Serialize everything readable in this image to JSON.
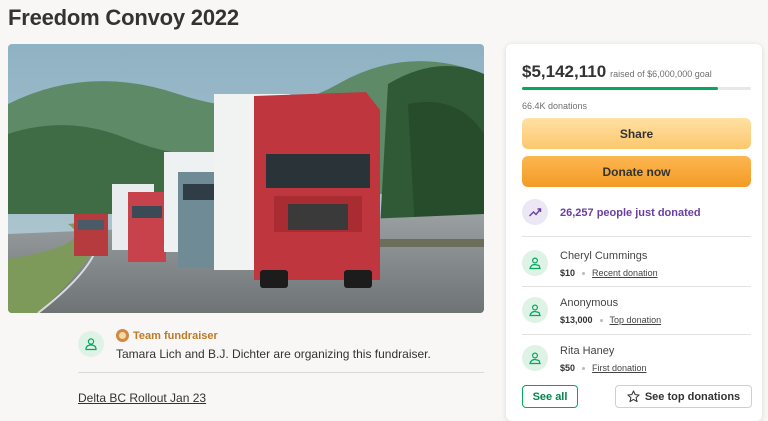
{
  "page": {
    "title": "Freedom Convoy 2022"
  },
  "campaign": {
    "raised_amount": "$5,142,110",
    "raised_goal_text": "raised of $6,000,000 goal",
    "progress_fraction": 0.857,
    "donation_count": "66.4K donations",
    "share_label": "Share",
    "donate_label": "Donate now",
    "recent_activity": "26,257 people just donated"
  },
  "donations": [
    {
      "name": "Cheryl Cummings",
      "amount": "$10",
      "tag": "Recent donation"
    },
    {
      "name": "Anonymous",
      "amount": "$13,000",
      "tag": "Top donation"
    },
    {
      "name": "Rita Haney",
      "amount": "$50",
      "tag": "First donation"
    }
  ],
  "buttons": {
    "see_all": "See all",
    "see_top": "See top donations"
  },
  "organizer": {
    "team_label": "Team fundraiser",
    "description": "Tamara Lich and B.J. Dichter are organizing this fundraiser."
  },
  "update": {
    "link_text": "Delta BC Rollout Jan 23"
  },
  "colors": {
    "accent_green": "#02a95c",
    "donate_orange": "#f39b25",
    "share_yellow": "#fcc76e",
    "trend_purple": "#6a3ea1"
  }
}
